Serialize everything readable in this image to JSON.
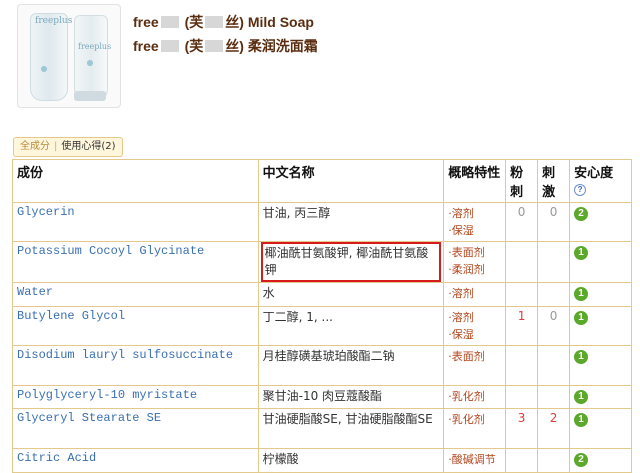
{
  "product": {
    "title_prefix": "free",
    "title_open": "(芙",
    "title_close": "丝)",
    "name_en": "Mild Soap",
    "name_cn": "柔润洗面霜"
  },
  "tabs": {
    "all": "全成分",
    "experience": "使用心得(2)"
  },
  "table": {
    "headers": [
      "成份",
      "中文名称",
      "概略特性",
      "粉刺",
      "刺激",
      "安心度"
    ],
    "rows": [
      {
        "name": "Glycerin",
        "cn": "甘油, 丙三醇",
        "func": [
          "·溶剂",
          "·保湿"
        ],
        "acne": "0",
        "irritation": "0",
        "safety": "2",
        "safety_color": "#5aa92b"
      },
      {
        "name": "Potassium Cocoyl Glycinate",
        "cn": "椰油酰甘氨酸钾, 椰油酰甘氨酸钾",
        "func": [
          "·表面剂",
          "·柔润剂"
        ],
        "acne": "",
        "irritation": "",
        "safety": "1",
        "safety_color": "#5aa92b"
      },
      {
        "name": "Water",
        "cn": "水",
        "func": [
          "·溶剂"
        ],
        "acne": "",
        "irritation": "",
        "safety": "1",
        "safety_color": "#5aa92b"
      },
      {
        "name": "Butylene Glycol",
        "cn": "丁二醇, 1, ...",
        "func": [
          "·溶剂",
          "·保湿"
        ],
        "acne": "1",
        "irritation": "0",
        "safety": "1",
        "safety_color": "#5aa92b"
      },
      {
        "name": "Disodium lauryl sulfosuccinate",
        "cn": "月桂醇磺基琥珀酸酯二钠",
        "func": [
          "·表面剂"
        ],
        "acne": "",
        "irritation": "",
        "safety": "1",
        "safety_color": "#5aa92b"
      },
      {
        "name": "Polyglyceryl-10 myristate",
        "cn": "聚甘油-10 肉豆蔻酸酯",
        "func": [
          "·乳化剂"
        ],
        "acne": "",
        "irritation": "",
        "safety": "1",
        "safety_color": "#5aa92b"
      },
      {
        "name": "Glyceryl Stearate SE",
        "cn": "甘油硬脂酸SE, 甘油硬脂酸酯SE",
        "func": [
          "·乳化剂"
        ],
        "acne": "3",
        "irritation": "2",
        "safety": "1",
        "safety_color": "#5aa92b"
      },
      {
        "name": "Citric Acid",
        "cn": "柠檬酸",
        "func": [
          "·酸碱调节"
        ],
        "acne": "",
        "irritation": "",
        "safety": "2",
        "safety_color": "#5aa92b"
      }
    ]
  },
  "help_icon": "?",
  "colors": {
    "ingredient_link": "#3a6fb0",
    "function_text": "#b3441c",
    "nonzero_rating": "#e23b3b",
    "zero_rating": "#999999",
    "table_border": "#e3c98c",
    "highlight": "#d71b1b"
  }
}
